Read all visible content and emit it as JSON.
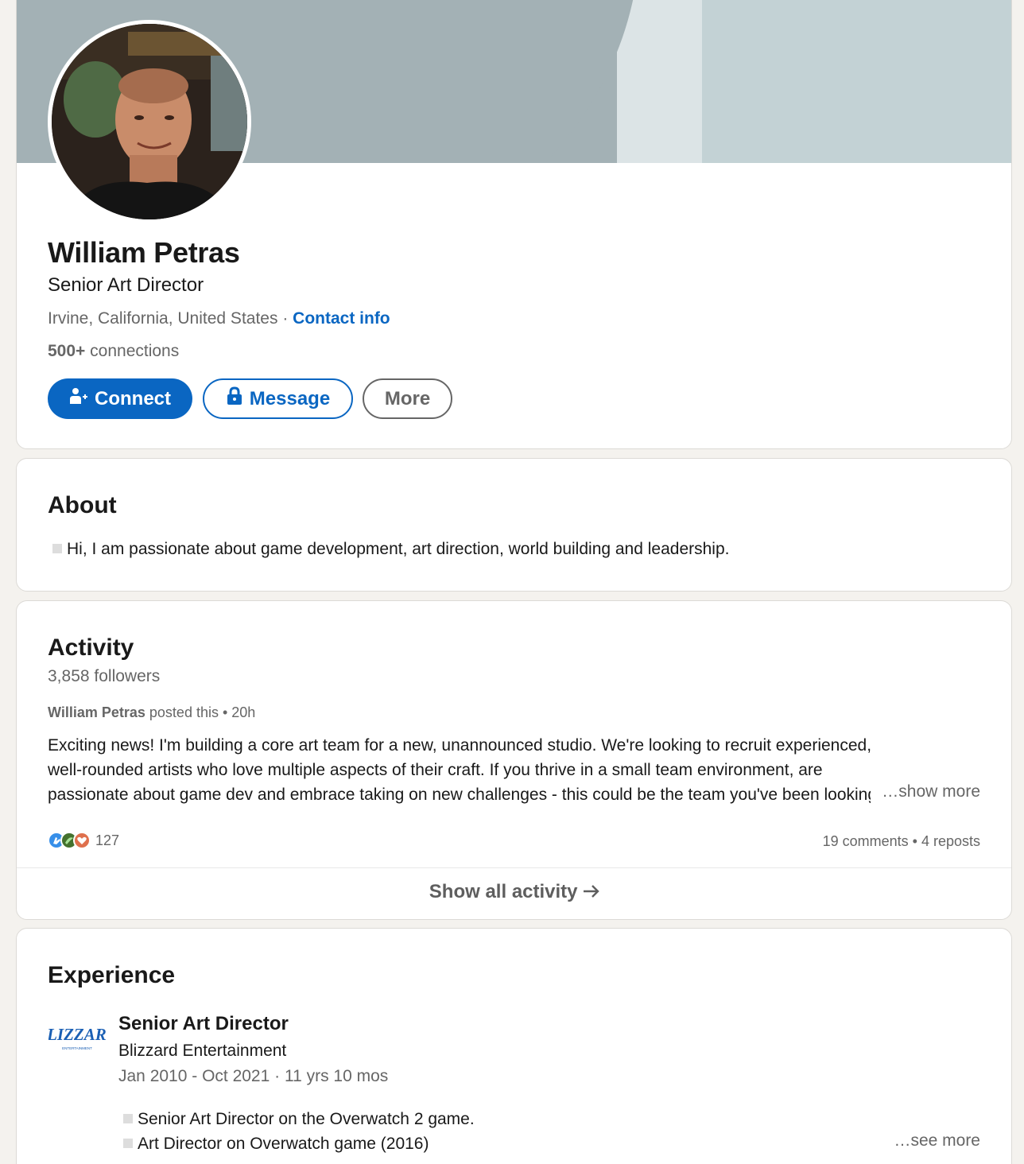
{
  "profile": {
    "name": "William Petras",
    "headline": "Senior Art Director",
    "location": "Irvine, California, United States",
    "separator": "·",
    "contact_info": "Contact info",
    "connections_count": "500+",
    "connections_label": "connections",
    "buttons": {
      "connect": "Connect",
      "message": "Message",
      "more": "More"
    },
    "colors": {
      "accent": "#0a66c2",
      "banner": "#a3b1b5"
    }
  },
  "about": {
    "title": "About",
    "text": "Hi, I am passionate about game development, art direction, world building and leadership."
  },
  "activity": {
    "title": "Activity",
    "followers": "3,858 followers",
    "post": {
      "author": "William Petras",
      "action": "posted this",
      "time": "• 20h",
      "lines": [
        "Exciting news! I'm building a core art team for a new, unannounced studio. We're looking to recruit experienced,",
        "well-rounded artists who love multiple aspects of their craft. If you thrive in a small team environment, are",
        "passionate about game dev and embrace taking on new challenges - this could be the team you've been looking for"
      ],
      "show_more": "…show more",
      "reaction_icons": [
        "clap-icon",
        "support-icon",
        "love-icon"
      ],
      "reaction_count": "127",
      "comments": "19 comments",
      "reposts": "4 reposts",
      "stats_separator": "•"
    },
    "show_all": "Show all activity"
  },
  "experience": {
    "title": "Experience",
    "items": [
      {
        "title": "Senior Art Director",
        "company": "Blizzard Entertainment",
        "logo_text": "BLIZZARD",
        "logo_subtext": "ENTERTAINMENT",
        "dates": "Jan 2010 - Oct 2021 · 11 yrs 10 mos",
        "bullets": [
          "Senior Art Director on the Overwatch 2 game.",
          "Art Director on Overwatch game (2016)"
        ],
        "see_more": "…see more"
      }
    ]
  }
}
